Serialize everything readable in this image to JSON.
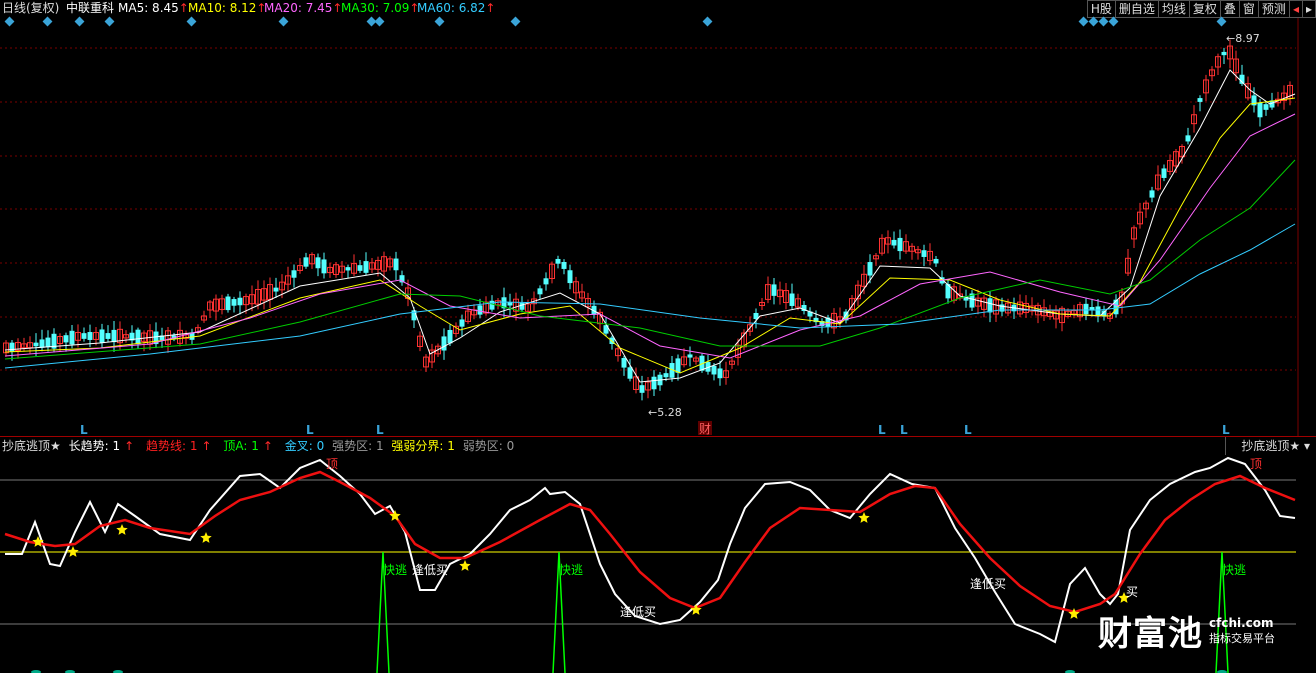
{
  "topbar": {
    "period": "日线(复权)",
    "stock_name": "中联重科",
    "ma5": {
      "label": "MA5: 8.45",
      "color": "#ffffff"
    },
    "ma10": {
      "label": "MA10: 8.12",
      "color": "#ffff00"
    },
    "ma20": {
      "label": "MA20: 7.45",
      "color": "#ff66ff"
    },
    "ma30": {
      "label": "MA30: 7.09",
      "color": "#00ff00"
    },
    "ma60": {
      "label": "MA60: 6.82",
      "color": "#33ccff"
    },
    "up_arrow": "↑",
    "buttons": [
      "H股",
      "删自选",
      "均线",
      "复权",
      "叠",
      "窗",
      "预测"
    ],
    "nav_left": "◂",
    "nav_right": "▸"
  },
  "main_chart": {
    "high_label": "8.97",
    "low_label": "5.28",
    "finance_marker": "财",
    "l_marker": "L"
  },
  "indicator": {
    "name": "抄底逃顶★",
    "long_trend": {
      "label": "长趋势: 1",
      "color": "#ffffff"
    },
    "trend_line": {
      "label": "趋势线: 1",
      "color": "#ff2020"
    },
    "top_a": {
      "label": "顶A: 1",
      "color": "#00ff00"
    },
    "golden_cross": {
      "label": "金叉: 0",
      "color": "#33ccff"
    },
    "strong_zone": {
      "label": "强势区: 1",
      "color": "#999999"
    },
    "boundary": {
      "label": "强弱分界: 1",
      "color": "#ffff00"
    },
    "weak_zone": {
      "label": "弱势区: 0",
      "color": "#999999"
    },
    "right_title": "抄底逃顶★",
    "annotations": {
      "top": "顶",
      "fast_escape": "快逃",
      "buy_low": "逢低买",
      "buy": "买"
    }
  },
  "watermark": {
    "brand": "财富池",
    "url": "cfchi.com",
    "tagline": "指标交易平台"
  }
}
